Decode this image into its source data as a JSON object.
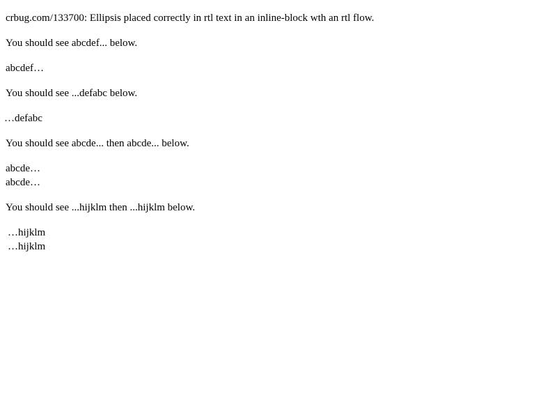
{
  "lines": [
    "crbug.com/133700: Ellipsis placed correctly in rtl text in an inline-block wth an rtl flow.",
    "You should see abcdef... below.",
    "abcdef…",
    "You should see ...defabc below.",
    "…defabc",
    "You should see abcde... then abcde... below.",
    "abcde…",
    "abcde…",
    "You should see ...hijklm then ...hijklm below.",
    "…hijklm",
    "…hijklm"
  ]
}
